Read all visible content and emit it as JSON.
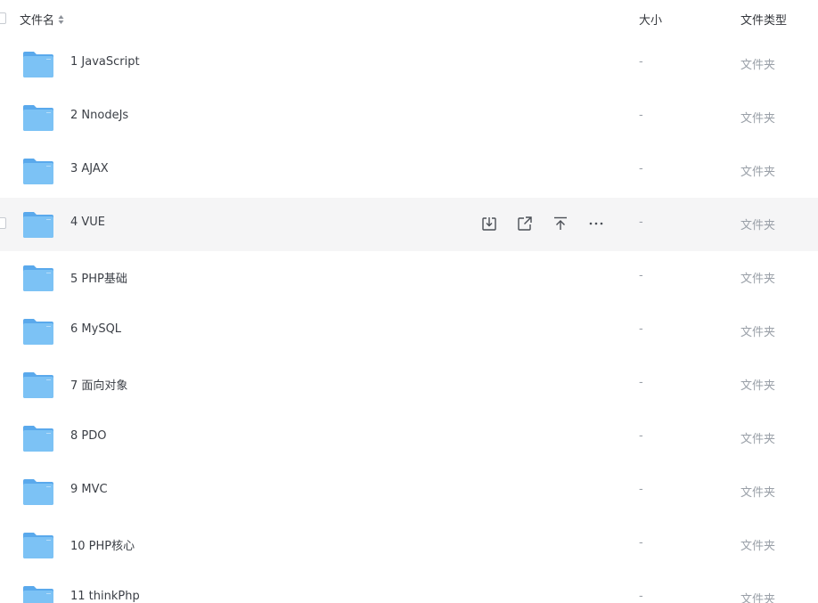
{
  "header": {
    "name_label": "文件名",
    "size_label": "大小",
    "type_label": "文件类型"
  },
  "files": [
    {
      "name": "1 JavaScript",
      "size": "-",
      "type": "文件夹"
    },
    {
      "name": "2 NnodeJs",
      "size": "-",
      "type": "文件夹"
    },
    {
      "name": "3 AJAX",
      "size": "-",
      "type": "文件夹"
    },
    {
      "name": "4 VUE",
      "size": "-",
      "type": "文件夹"
    },
    {
      "name": "5 PHP基础",
      "size": "-",
      "type": "文件夹"
    },
    {
      "name": "6 MySQL",
      "size": "-",
      "type": "文件夹"
    },
    {
      "name": "7 面向对象",
      "size": "-",
      "type": "文件夹"
    },
    {
      "name": "8 PDO",
      "size": "-",
      "type": "文件夹"
    },
    {
      "name": "9 MVC",
      "size": "-",
      "type": "文件夹"
    },
    {
      "name": "10 PHP核心",
      "size": "-",
      "type": "文件夹"
    },
    {
      "name": "11 thinkPhp",
      "size": "-",
      "type": "文件夹"
    }
  ],
  "hovered_row": 3,
  "row_actions": [
    "download-icon",
    "share-icon",
    "move-to-top-icon",
    "more-icon"
  ],
  "colors": {
    "folder_front": "#7cc2f5",
    "folder_back": "#5aa9ec",
    "row_hover_bg": "#f5f5f6",
    "muted_text": "#9aa0a8"
  }
}
